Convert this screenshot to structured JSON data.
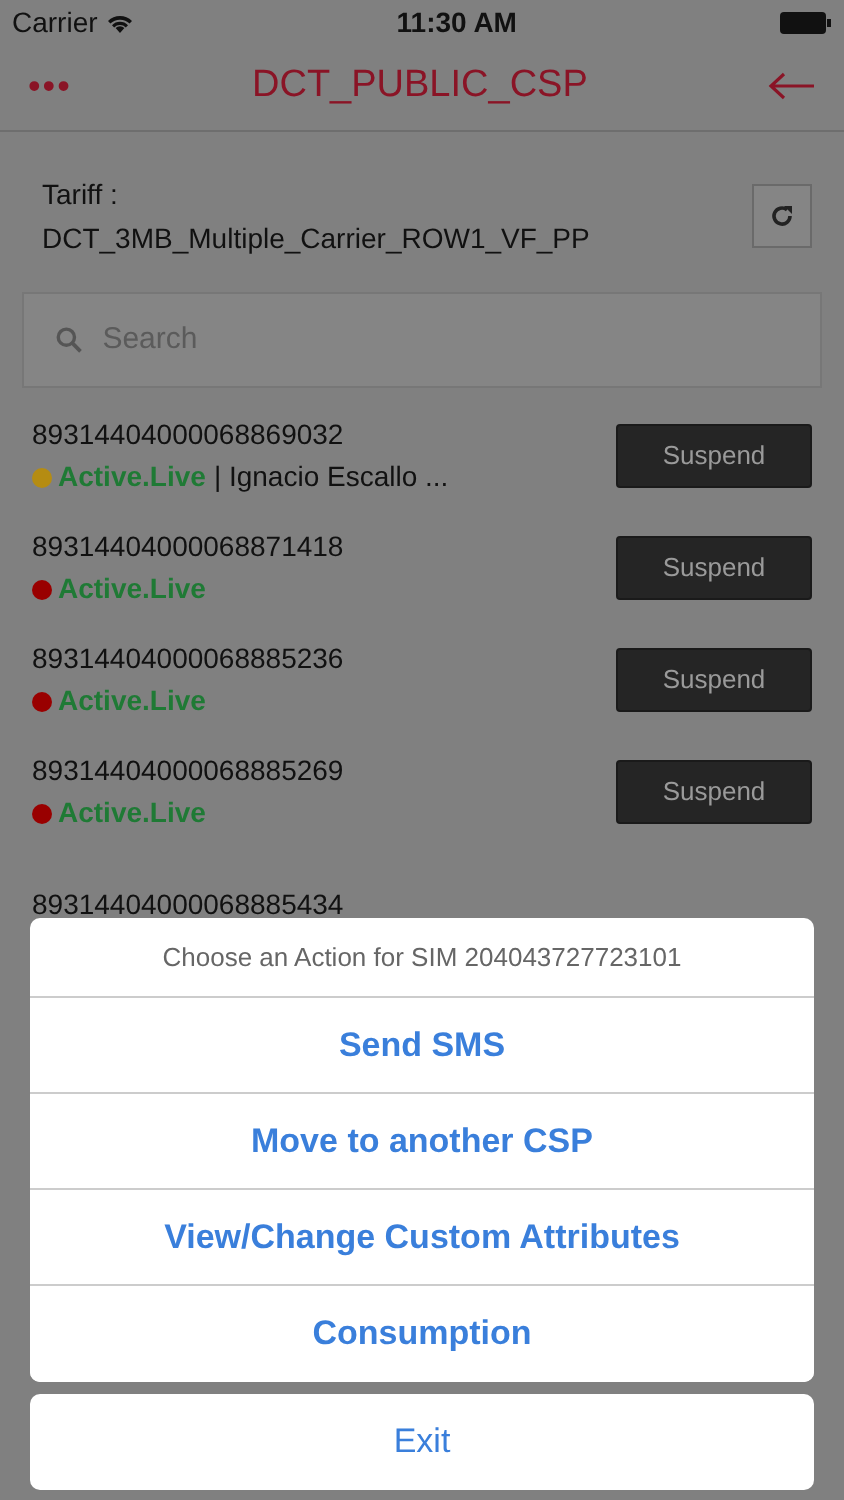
{
  "status_bar": {
    "carrier": "Carrier",
    "time": "11:30 AM"
  },
  "nav": {
    "title": "DCT_PUBLIC_CSP",
    "menu": "•••"
  },
  "tariff": {
    "label": "Tariff :",
    "value": "DCT_3MB_Multiple_Carrier_ROW1_VF_PP"
  },
  "search": {
    "placeholder": "Search"
  },
  "sims": [
    {
      "number": "89314404000068869032",
      "status": "Active.Live",
      "extra": "| Ignacio Escallo ...",
      "color": "#b58c12",
      "button": "Suspend"
    },
    {
      "number": "89314404000068871418",
      "status": "Active.Live",
      "color": "#990000",
      "button": "Suspend"
    },
    {
      "number": "89314404000068885236",
      "status": "Active.Live",
      "color": "#990000",
      "button": "Suspend"
    },
    {
      "number": "89314404000068885269",
      "status": "Active.Live",
      "color": "#990000",
      "button": "Suspend"
    },
    {
      "number": "89314404000068885434"
    }
  ],
  "action_sheet": {
    "title": "Choose an Action for SIM 204043727723101",
    "actions": [
      "Send SMS",
      "Move to another CSP",
      "View/Change Custom Attributes",
      "Consumption"
    ],
    "cancel": "Exit"
  }
}
